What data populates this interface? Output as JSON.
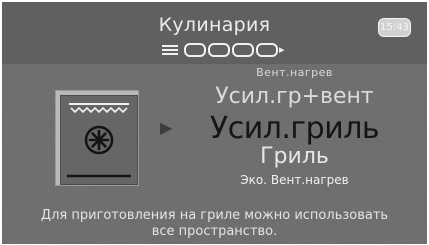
{
  "header": {
    "title": "Кулинария",
    "time": "15:43",
    "menu_icon": "hamburger-menu-icon",
    "steps": {
      "total": 4,
      "current": 1
    }
  },
  "oven_icon": "convection-fan-grill-icon",
  "mode_list": {
    "items": [
      "Вент.нагрев",
      "Усил.гр+вент",
      "Усил.гриль",
      "Гриль",
      "Эко. Вент.нагрев"
    ],
    "selected_index": 2
  },
  "description": {
    "line1": "Для приготовления на гриле можно использовать",
    "line2": "все пространство."
  },
  "colors": {
    "background": "#6e6e6e",
    "header": "#606060",
    "selected_text": "#151515",
    "text": "#e6e6e6"
  }
}
